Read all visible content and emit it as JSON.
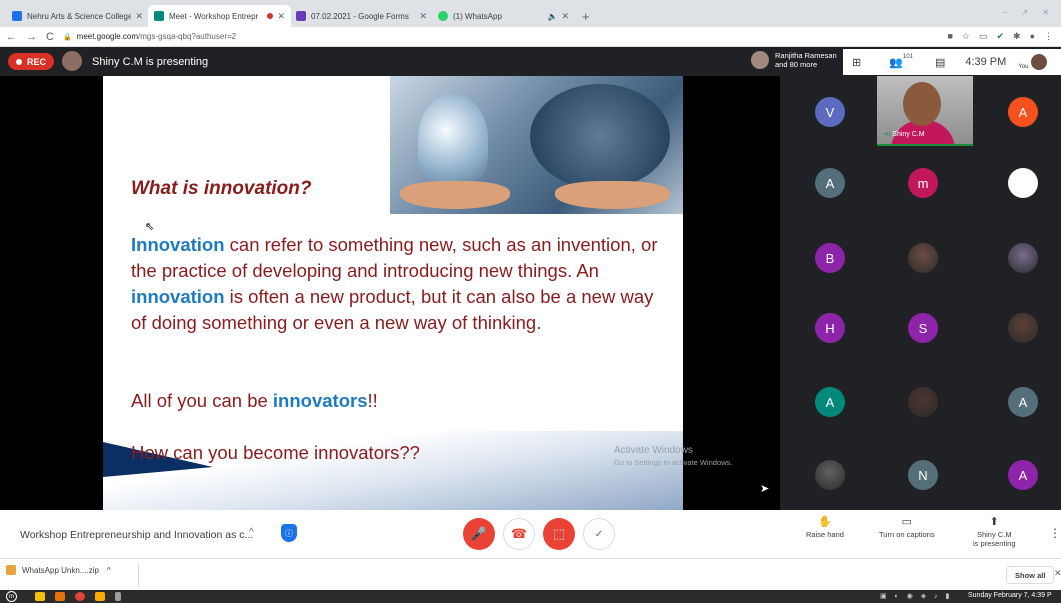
{
  "browser": {
    "tabs": [
      {
        "title": "Nehru Arts & Science College",
        "favicon_color": "#1a73e8"
      },
      {
        "title": "Meet - Workshop Entrepr",
        "favicon_color": "#00897b",
        "active": true
      },
      {
        "title": "07.02.2021 - Google Forms",
        "favicon_color": "#673ab7"
      },
      {
        "title": "(1) WhatsApp",
        "favicon_color": "#25d366"
      }
    ],
    "url_host": "meet.google.com",
    "url_path": "/mgs-gsqa-qbq?authuser=2"
  },
  "meet": {
    "rec_label": "REC",
    "presenting_text": "Shiny C.M is presenting",
    "participants_summary": "Ranjitha Ramesan",
    "participants_more": "and 80 more",
    "participant_count": "101",
    "time": "4:39 PM",
    "you_label": "You",
    "self_name": "Shiny C.M",
    "meeting_title": "Workshop Entrepreneurship and Innovation as c...",
    "raise_hand": "Raise hand",
    "captions": "Turn on captions",
    "presenting_line1": "Shiny C.M",
    "presenting_line2": "is presenting"
  },
  "slide": {
    "title": "What is innovation?",
    "body_hl1": "Innovation",
    "body_part1": " can refer to something new, such as an invention, or the practice of developing and introducing new things. An ",
    "body_hl2": "innovation",
    "body_part2": " is often a new product, but it can also be a new way of doing something or even a new way of thinking.",
    "line2_prefix": "All of you can be ",
    "line2_hl": "innovators",
    "line2_suffix": "!!",
    "line3": "How can you become innovators??"
  },
  "watermark": {
    "line1": "Activate Windows",
    "line2": "Go to Settings to activate Windows."
  },
  "grid": [
    {
      "initial": "V",
      "color": "#5c6bc0"
    },
    {
      "initial": "A",
      "color": "#f4511e"
    },
    {
      "initial": "A",
      "color": "#546e7a"
    },
    {
      "initial": "m",
      "color": "#c2185b"
    },
    {
      "initial": "",
      "color": "#ffffff",
      "photo": true
    },
    {
      "initial": "B",
      "color": "#8e24aa"
    },
    {
      "initial": "",
      "color": "#6d4c41",
      "photo": true
    },
    {
      "initial": "",
      "color": "#7b6b8f",
      "photo": true
    },
    {
      "initial": "H",
      "color": "#8e24aa"
    },
    {
      "initial": "S",
      "color": "#8e24aa"
    },
    {
      "initial": "",
      "color": "#5d4037",
      "photo": true
    },
    {
      "initial": "A",
      "color": "#00897b"
    },
    {
      "initial": "",
      "color": "#4e342e",
      "photo": true
    },
    {
      "initial": "A",
      "color": "#546e7a"
    },
    {
      "initial": "",
      "color": "#616161",
      "photo": true
    },
    {
      "initial": "N",
      "color": "#546e7a"
    },
    {
      "initial": "A",
      "color": "#8e24aa"
    }
  ],
  "download": {
    "file": "WhatsApp Unkn....zip",
    "show_all": "Show all"
  },
  "taskbar": {
    "datetime": "Sunday February 7, 4:39 P"
  }
}
